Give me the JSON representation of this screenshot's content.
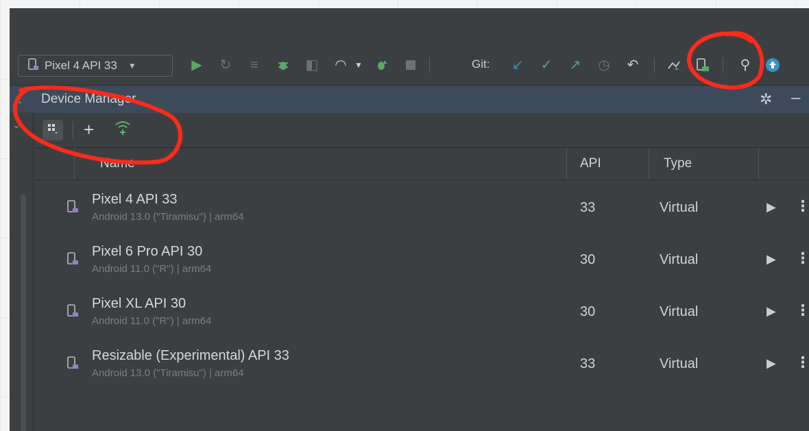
{
  "toolbar": {
    "device_selector_label": "Pixel 4 API 33",
    "git_label": "Git:"
  },
  "device_manager": {
    "title": "Device Manager"
  },
  "table": {
    "columns": [
      "Name",
      "API",
      "Type"
    ],
    "rows": [
      {
        "name": "Pixel 4 API 33",
        "sub": "Android 13.0 (\"Tiramisu\") | arm64",
        "api": "33",
        "type": "Virtual"
      },
      {
        "name": "Pixel 6 Pro API 30",
        "sub": "Android 11.0 (\"R\") | arm64",
        "api": "30",
        "type": "Virtual"
      },
      {
        "name": "Pixel XL API 30",
        "sub": "Android 11.0 (\"R\") | arm64",
        "api": "30",
        "type": "Virtual"
      },
      {
        "name": "Resizable (Experimental) API 33",
        "sub": "Android 13.0 (\"Tiramisu\") | arm64",
        "api": "33",
        "type": "Virtual"
      }
    ]
  },
  "colors": {
    "annotation": "#ff2a1a",
    "run_green": "#59a869",
    "accent_blue": "#3592c4"
  }
}
